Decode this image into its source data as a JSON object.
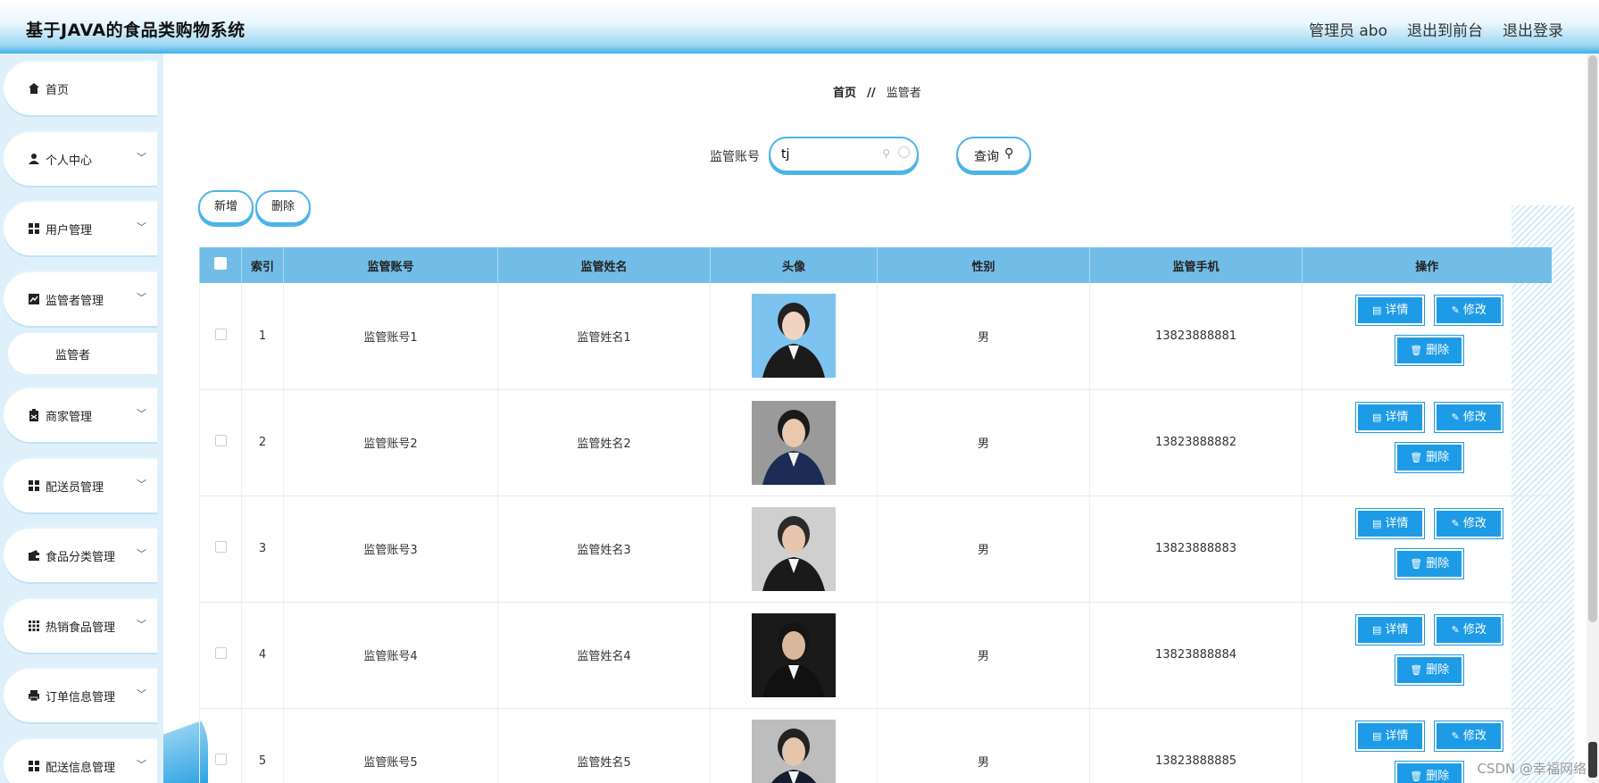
{
  "header": {
    "title": "基于JAVA的食品类购物系统",
    "links": [
      "管理员 abo",
      "退出到前台",
      "退出登录"
    ]
  },
  "sidebar": {
    "items": [
      {
        "label": "首页",
        "icon": "home-icon"
      },
      {
        "label": "个人中心",
        "icon": "user-icon"
      },
      {
        "label": "用户管理",
        "icon": "grid-icon"
      },
      {
        "label": "监管者管理",
        "icon": "chart-icon"
      },
      {
        "label": "商家管理",
        "icon": "clipboard-icon"
      },
      {
        "label": "配送员管理",
        "icon": "grid-icon"
      },
      {
        "label": "食品分类管理",
        "icon": "wallet-icon"
      },
      {
        "label": "热销食品管理",
        "icon": "apps-icon"
      },
      {
        "label": "订单信息管理",
        "icon": "print-icon"
      },
      {
        "label": "配送信息管理",
        "icon": "grid-icon"
      }
    ],
    "sub_item": "监管者"
  },
  "breadcrumb": {
    "home": "首页",
    "sep": "//",
    "current": "监管者"
  },
  "search": {
    "label": "监管账号",
    "value": "tj",
    "button": "查询"
  },
  "actions": {
    "add": "新增",
    "delete": "删除"
  },
  "table": {
    "headers": [
      "索引",
      "监管账号",
      "监管姓名",
      "头像",
      "性别",
      "监管手机",
      "操作"
    ],
    "rows": [
      {
        "index": "1",
        "account": "监管账号1",
        "name": "监管姓名1",
        "gender": "男",
        "phone": "13823888881"
      },
      {
        "index": "2",
        "account": "监管账号2",
        "name": "监管姓名2",
        "gender": "男",
        "phone": "13823888882"
      },
      {
        "index": "3",
        "account": "监管账号3",
        "name": "监管姓名3",
        "gender": "男",
        "phone": "13823888883"
      },
      {
        "index": "4",
        "account": "监管账号4",
        "name": "监管姓名4",
        "gender": "男",
        "phone": "13823888884"
      },
      {
        "index": "5",
        "account": "监管账号5",
        "name": "监管姓名5",
        "gender": "男",
        "phone": "13823888885"
      }
    ],
    "ops": {
      "detail": "详情",
      "edit": "修改",
      "delete": "删除"
    }
  },
  "watermark": "CSDN @幸福网络",
  "colors": {
    "accent": "#1e9be6",
    "header_row": "#72bde8",
    "border": "#4bb4ea"
  }
}
